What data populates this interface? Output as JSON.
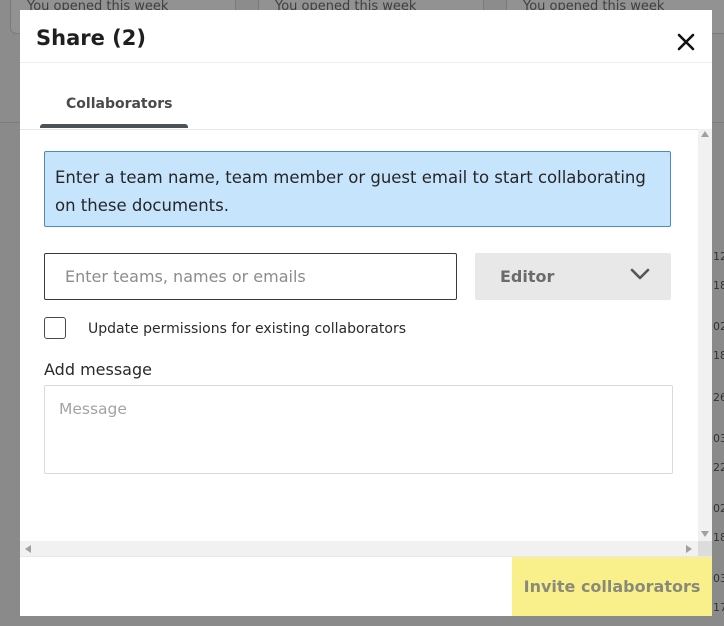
{
  "background": {
    "cards": [
      {
        "text": "You opened this week"
      },
      {
        "text": "You opened this week"
      },
      {
        "text": "You opened this week"
      }
    ],
    "side_numbers": [
      "12",
      "18",
      "02",
      "18",
      "26",
      "03",
      "22",
      "02",
      "18",
      "03",
      "17"
    ]
  },
  "modal": {
    "title": "Share (2)",
    "close_icon": "close-icon",
    "tabs": [
      {
        "label": "Collaborators",
        "active": true
      }
    ],
    "info_text": "Enter a team name, team member or guest email to start collaborating on these documents.",
    "invite_input": {
      "placeholder": "Enter teams, names or emails",
      "value": ""
    },
    "role_select": {
      "selected": "Editor",
      "icon": "chevron-down-icon"
    },
    "update_permissions": {
      "label": "Update permissions for existing collaborators",
      "checked": false
    },
    "message": {
      "heading": "Add message",
      "placeholder": "Message",
      "value": ""
    },
    "invite_button": {
      "label": "Invite collaborators"
    }
  },
  "colors": {
    "info_bg": "#c7e4fd",
    "info_border": "#4e8ac2",
    "invite_button_bg": "#faf08b",
    "tab_underline": "#4b5258",
    "overlay": "#8a8a8a"
  }
}
